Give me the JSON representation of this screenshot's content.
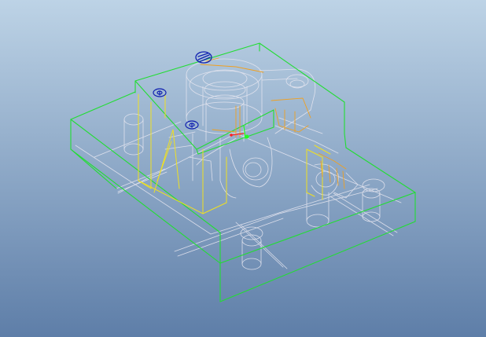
{
  "viewport": {
    "background_top": "#bdd3e6",
    "background_bottom": "#5e7ea8"
  },
  "model": {
    "colors": {
      "base_edges": "#22dd33",
      "hidden_edges": "#e6e6f0",
      "support_edges": "#f0e020",
      "accent_edges": "#f0a020",
      "screw_edges": "#1020b0",
      "datum_x": "#ff2020",
      "datum_y": "#20ff20"
    },
    "icons": {
      "screw_top": "slotted-screw-icon",
      "screw_left": "cap-screw-icon",
      "screw_mid": "cap-screw-icon",
      "datum": "coordinate-system-icon"
    }
  }
}
